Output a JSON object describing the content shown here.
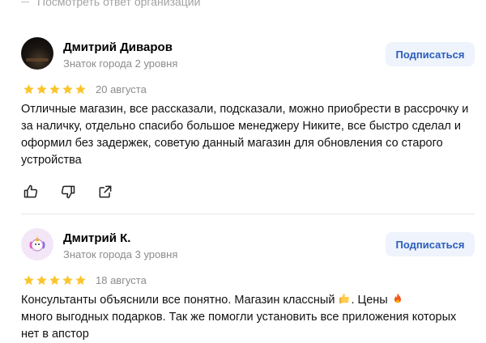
{
  "top_link": "Посмотреть ответ организации",
  "reviews": [
    {
      "author": "Дмитрий Диваров",
      "level": "Знаток города 2 уровня",
      "subscribe_label": "Подписаться",
      "rating": 5,
      "date": "20 августа",
      "text": "Отличные магазин, все рассказали, подсказали, можно приобрести в рассрочку и за наличку, отдельно спасибо большое менеджеру Никите, все быстро сделал и оформил без задержек, советую данный магазин для обновления со старого устройства"
    },
    {
      "author": "Дмитрий К.",
      "level": "Знаток города 3 уровня",
      "subscribe_label": "Подписаться",
      "rating": 5,
      "date": "18 августа",
      "text_part1": "Консультанты объяснили все понятно. Магазин классный",
      "text_part2": ". Цены",
      "text_part3": "много выгодных подарков. Так же помогли установить все приложения которых нет в апстор"
    }
  ],
  "icons": {
    "like": "thumb-up-icon",
    "dislike": "thumb-down-icon",
    "share": "share-icon",
    "star": "star-icon",
    "thumbs_emoji": "thumbs-up-emoji",
    "fire_emoji": "fire-emoji"
  },
  "colors": {
    "star": "#fcc42c",
    "subscribe_bg": "#eef3fc",
    "subscribe_text": "#2b5dbb",
    "muted": "#8c8c8c"
  }
}
